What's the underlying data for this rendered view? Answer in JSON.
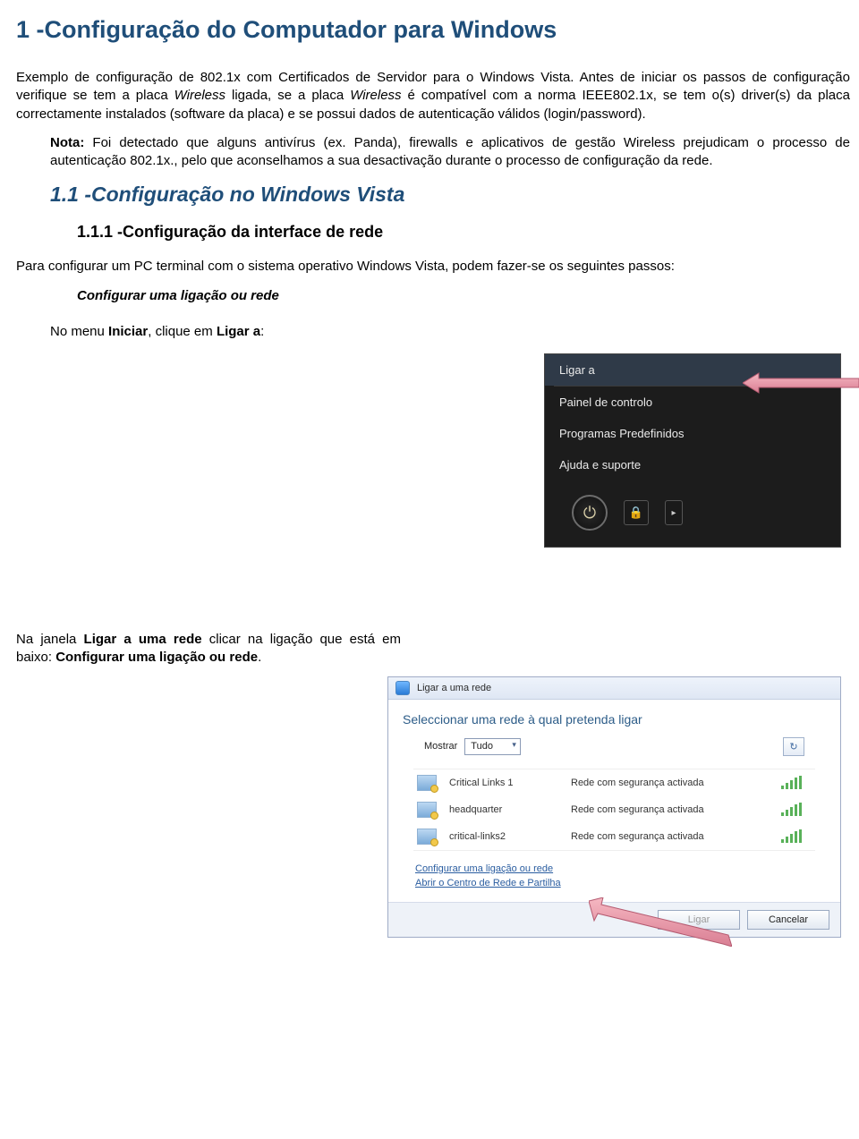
{
  "title": "1 -Configuração do Computador para Windows",
  "intro1a": "Exemplo de configuração de 802.1x com Certificados de Servidor para o Windows Vista. Antes de iniciar os passos de configuração verifique se tem a placa ",
  "intro1b_italic": "Wireless",
  "intro1c": " ligada, se a placa ",
  "intro1d_italic": "Wireless",
  "intro1e": " é compatível com a norma IEEE802.1x, se tem o(s) driver(s) da placa correctamente instalados (software da placa) e se possui dados de autenticação válidos (login/password).",
  "note_label": "Nota:",
  "note_text": " Foi detectado que alguns antivírus (ex. Panda), firewalls e aplicativos de gestão Wireless prejudicam o processo de autenticação 802.1x., pelo que aconselhamos a sua desactivação durante o processo de configuração da rede.",
  "h2": "1.1 -Configuração no Windows Vista",
  "h3": "1.1.1 -Configuração da interface de rede",
  "para_passos": "Para configurar um PC terminal com o sistema operativo Windows Vista, podem fazer-se os seguintes passos:",
  "step_config": "Configurar uma ligação ou rede",
  "sub_step_a": "No menu ",
  "sub_step_b_bold": "Iniciar",
  "sub_step_c": ", clique em ",
  "sub_step_d_bold": "Ligar a",
  "sub_step_e": ":",
  "caption2_a": "Na janela ",
  "caption2_b_bold": "Ligar a uma rede",
  "caption2_c": " clicar na ligação que está em baixo: ",
  "caption2_d_bold": "Configurar uma ligação ou rede",
  "caption2_e": ".",
  "startmenu": {
    "items": [
      "Ligar a",
      "Painel de controlo",
      "Programas Predefinidos",
      "Ajuda e suporte"
    ],
    "power_glyph": "⏻",
    "lock_glyph": "🔒",
    "arrow_glyph": "▸"
  },
  "connwin": {
    "title": "Ligar a uma rede",
    "heading": "Seleccionar uma rede à qual pretenda ligar",
    "filter_label": "Mostrar",
    "filter_value": "Tudo",
    "refresh_glyph": "↻",
    "networks": [
      {
        "name": "Critical Links 1",
        "status": "Rede com segurança activada"
      },
      {
        "name": "headquarter",
        "status": "Rede com segurança activada"
      },
      {
        "name": "critical-links2",
        "status": "Rede com segurança activada"
      }
    ],
    "link_setup": "Configurar uma ligação ou rede",
    "link_center": "Abrir o Centro de Rede e Partilha",
    "btn_connect": "Ligar",
    "btn_cancel": "Cancelar"
  }
}
